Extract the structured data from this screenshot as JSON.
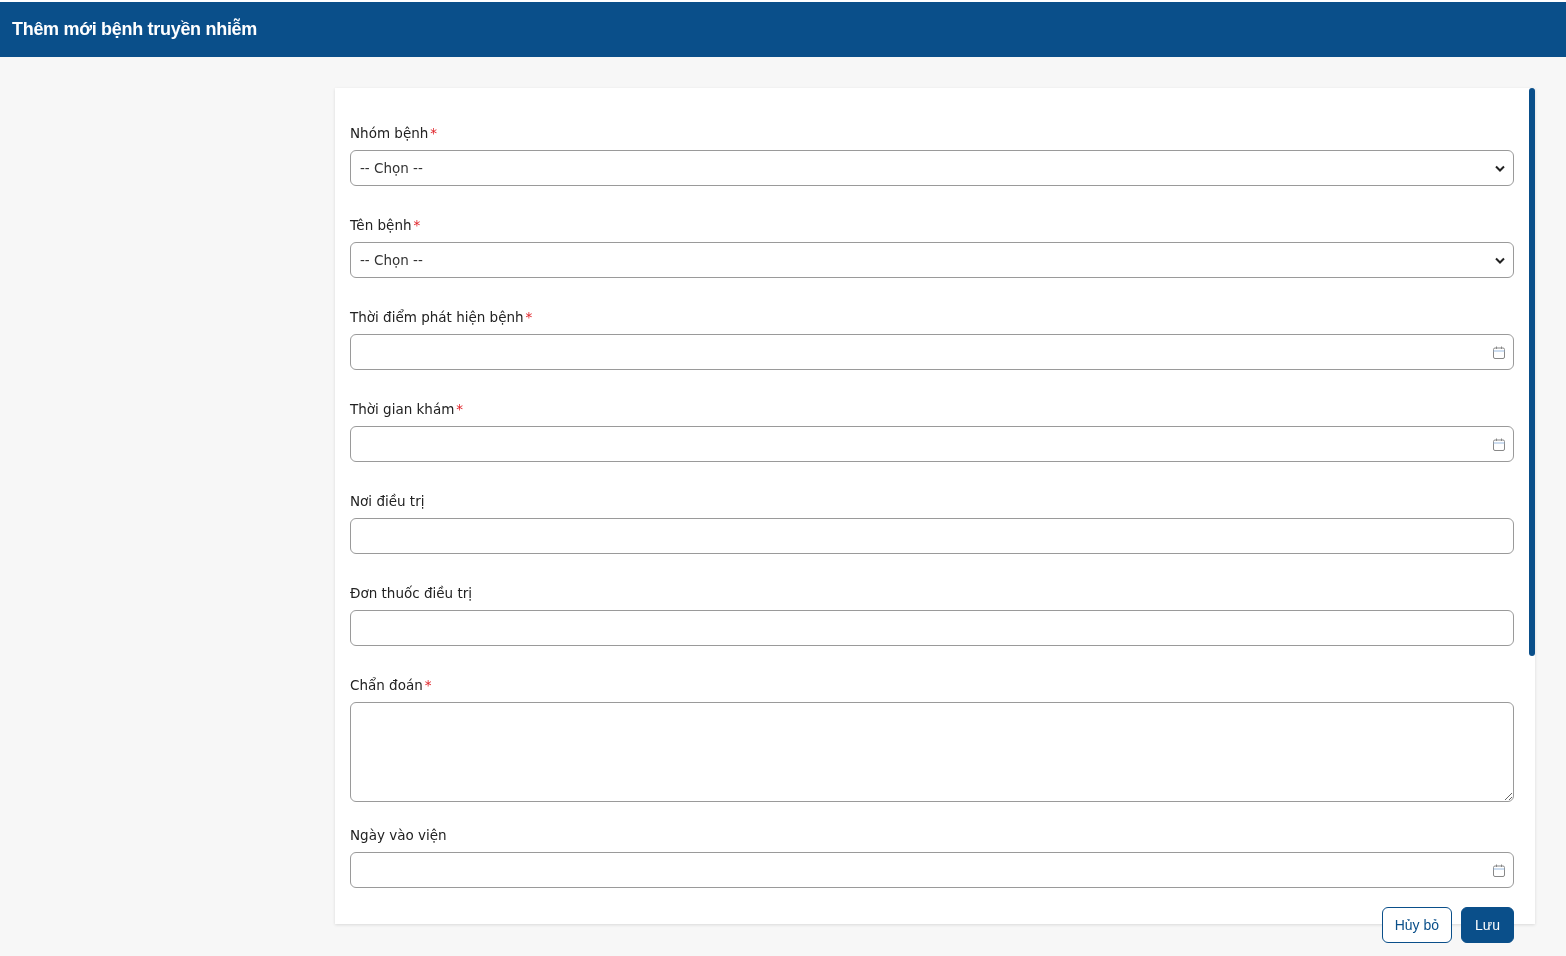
{
  "header": {
    "title": "Thêm mới bệnh truyền nhiễm"
  },
  "fields": [
    {
      "kind": "select",
      "label": "Nhóm bệnh",
      "required": true,
      "value": "-- Chọn --"
    },
    {
      "kind": "select",
      "label": "Tên bệnh",
      "required": true,
      "value": "-- Chọn --"
    },
    {
      "kind": "date",
      "label": "Thời điểm phát hiện bệnh",
      "required": true
    },
    {
      "kind": "date",
      "label": "Thời gian khám",
      "required": true
    },
    {
      "kind": "text",
      "label": "Nơi điều trị",
      "required": false
    },
    {
      "kind": "text",
      "label": "Đơn thuốc điều trị",
      "required": false
    },
    {
      "kind": "textarea",
      "label": "Chẩn đoán",
      "required": true
    },
    {
      "kind": "date",
      "label": "Ngày vào viện",
      "required": false
    }
  ],
  "required_mark": "*",
  "buttons": [
    {
      "kind": "secondary",
      "label": "Hủy bỏ"
    },
    {
      "kind": "primary",
      "label": "Lưu"
    }
  ]
}
